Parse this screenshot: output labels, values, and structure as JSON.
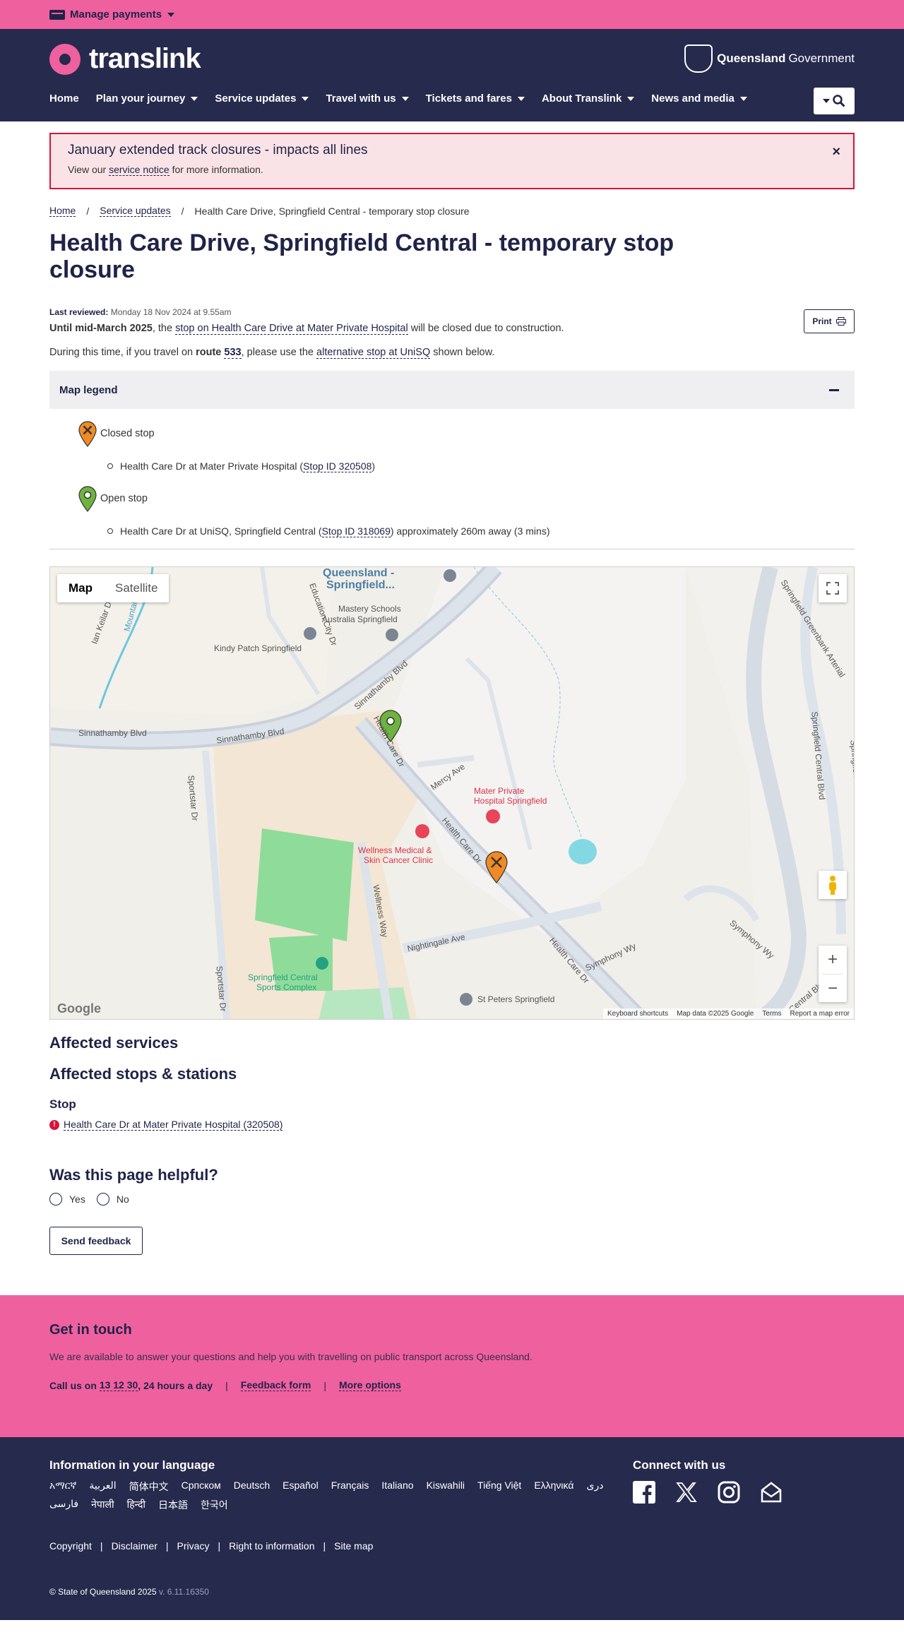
{
  "topbar": {
    "manage_payments": "Manage payments"
  },
  "header": {
    "logo": "translink",
    "gov_bold": "Queensland",
    "gov_rest": "Government",
    "nav": [
      "Home",
      "Plan your journey",
      "Service updates",
      "Travel with us",
      "Tickets and fares",
      "About Translink",
      "News and media"
    ]
  },
  "alert": {
    "title": "January extended track closures - impacts all lines",
    "pre": "View our",
    "link": "service notice",
    "post": "for more information.",
    "close": "×"
  },
  "breadcrumb": [
    "Home",
    "Service updates",
    "Health Care Drive, Springfield Central - temporary stop closure"
  ],
  "page": {
    "title": "Health Care Drive, Springfield Central - temporary stop closure",
    "print": "Print",
    "last_reviewed_label": "Last reviewed:",
    "last_reviewed": "Monday 18 Nov 2024 at 9.55am",
    "p1_bold": "Until mid-March 2025",
    "p1_a": ", the",
    "p1_link": "stop on Health Care Drive at Mater Private Hospital",
    "p1_b": "will be closed due to construction.",
    "p2_a": "During this time, if you travel on",
    "p2_route_label": "route",
    "p2_route": "533",
    "p2_b": ", please use the",
    "p2_link": "alternative stop at UniSQ",
    "p2_c": "shown below."
  },
  "legend": {
    "heading": "Map legend",
    "closed_label": "Closed stop",
    "closed_item_pre": "Health Care Dr at Mater Private Hospital (",
    "closed_item_link": "Stop ID 320508",
    "closed_item_post": ")",
    "open_label": "Open stop",
    "open_item_pre": "Health Care Dr at UniSQ, Springfield Central (",
    "open_item_link": "Stop ID 318069",
    "open_item_post": ") approximately 260m away (3 mins)"
  },
  "map": {
    "tab_map": "Map",
    "tab_satellite": "Satellite",
    "labels": {
      "queensland": "Queensland -",
      "springfield": "Springfield...",
      "mastery": "Mastery Schools",
      "mastery2": "Australia Springfield",
      "kindy": "Kindy Patch Springfield",
      "sinnathamby1": "Sinnathamby Blvd",
      "sinnathamby2": "Sinnathamby Blvd",
      "sinnathamby3": "Sinnathamby Blvd",
      "health1": "Health Care Dr",
      "health2": "Health Care Dr",
      "health3": "Health Care Dr",
      "mercy": "Mercy Ave",
      "mater": "Mater Private",
      "mater2": "Hospital Springfield",
      "wellness": "Wellness Medical &",
      "wellness2": "Skin Cancer Clinic",
      "wellnessway": "Wellness Way",
      "nightingale": "Nightingale Ave",
      "sportstar1": "Sportstar Dr",
      "sportstar2": "Sportstar Dr",
      "sports": "Springfield Central",
      "sports2": "Sports Complex",
      "peters": "St Peters Springfield",
      "symphony": "Symphony Wy",
      "symphony2": "Symphony Wy",
      "scb1": "Springfield Central Blvd",
      "scb2": "Springfield Central Blvd",
      "scb3": "Central Blvd",
      "arterial": "Springfield Greenbank Arterial",
      "education": "Education City Dr",
      "ian": "Ian Keilar Dr",
      "mountain": "Mountain"
    },
    "google": "Google",
    "footer": [
      "Keyboard shortcuts",
      "Map data ©2025 Google",
      "Terms",
      "Report a map error"
    ],
    "zoom_in": "+",
    "zoom_out": "−"
  },
  "affected": {
    "services": "Affected services",
    "stops": "Affected stops & stations",
    "stop_h": "Stop",
    "stop_link": "Health Care Dr at Mater Private Hospital (320508)"
  },
  "feedback": {
    "question": "Was this page helpful?",
    "yes": "Yes",
    "no": "No",
    "send": "Send feedback"
  },
  "contact": {
    "title": "Get in touch",
    "desc": "We are available to answer your questions and help you with travelling on public transport across Queensland.",
    "call_pre": "Call us on",
    "phone": "13 12 30",
    "call_post": ", 24 hours a day",
    "feedback_form": "Feedback form",
    "more": "More options"
  },
  "footer": {
    "lang_heading": "Information in your language",
    "languages": [
      "አማርኛ",
      "العربية",
      "简体中文",
      "Српском",
      "Deutsch",
      "Español",
      "Français",
      "Italiano",
      "Kiswahili",
      "Tiếng Việt",
      "Ελληνικά",
      "دری",
      "فارسی",
      "नेपाली",
      "हिन्दी",
      "日本語",
      "한국어"
    ],
    "connect": "Connect with us",
    "links": [
      "Copyright",
      "Disclaimer",
      "Privacy",
      "Right to information",
      "Site map"
    ],
    "copyright": "© State of Queensland 2025",
    "version": "v. 6.11.16350"
  },
  "colors": {
    "pink": "#ef609f",
    "navy": "#262a4d",
    "alert_red": "#d7153a",
    "closed_pin": "#f08a24",
    "open_pin": "#6db33f"
  }
}
